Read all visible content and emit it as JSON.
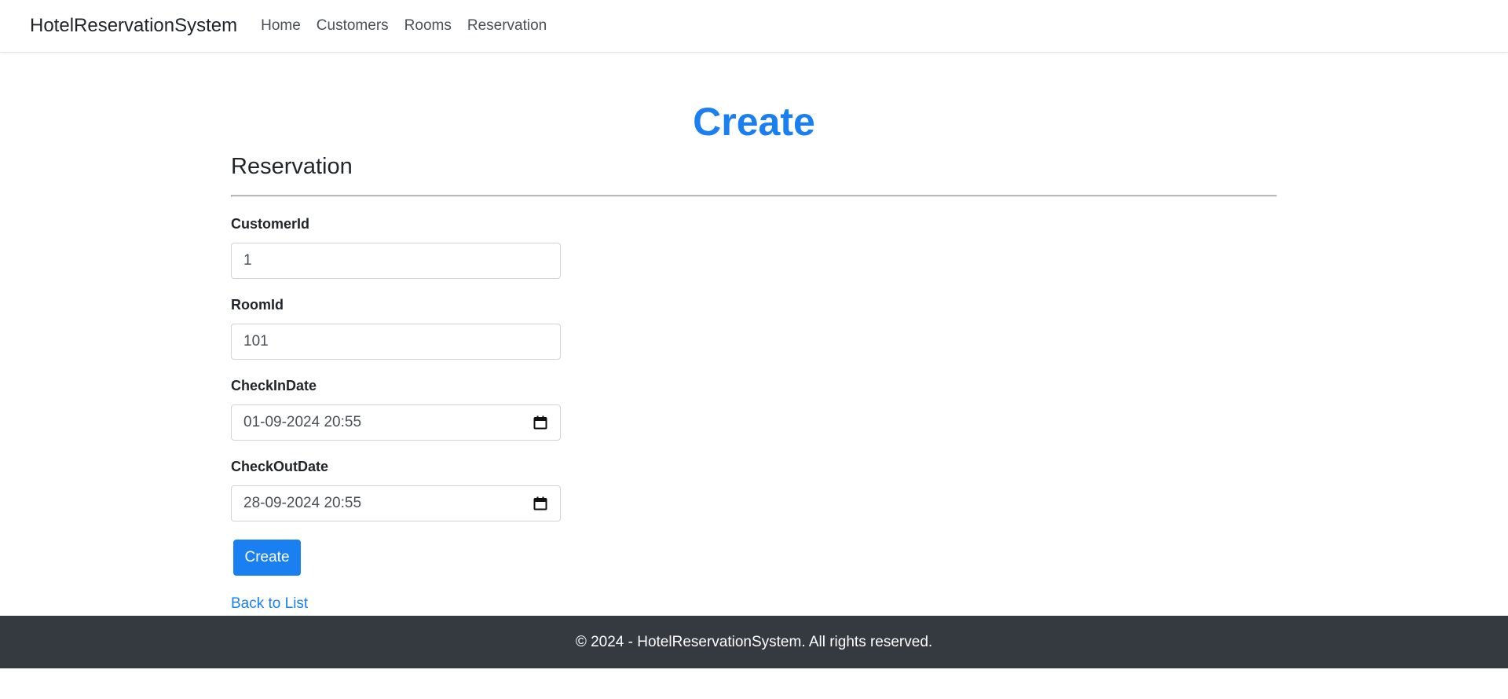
{
  "navbar": {
    "brand": "HotelReservationSystem",
    "links": [
      "Home",
      "Customers",
      "Rooms",
      "Reservation"
    ]
  },
  "page": {
    "title": "Create",
    "section": "Reservation"
  },
  "form": {
    "customer_id": {
      "label": "CustomerId",
      "value": "1"
    },
    "room_id": {
      "label": "RoomId",
      "value": "101"
    },
    "check_in": {
      "label": "CheckInDate",
      "value": "01-09-2024 20:55",
      "icon": "calendar-icon"
    },
    "check_out": {
      "label": "CheckOutDate",
      "value": "28-09-2024 20:55",
      "icon": "calendar-icon"
    },
    "submit_label": "Create"
  },
  "back_link": "Back to List",
  "footer": {
    "text": "© 2024 - HotelReservationSystem. All rights reserved."
  },
  "colors": {
    "accent": "#1a7ff0",
    "footer_bg": "#343a40",
    "text": "#212529"
  }
}
